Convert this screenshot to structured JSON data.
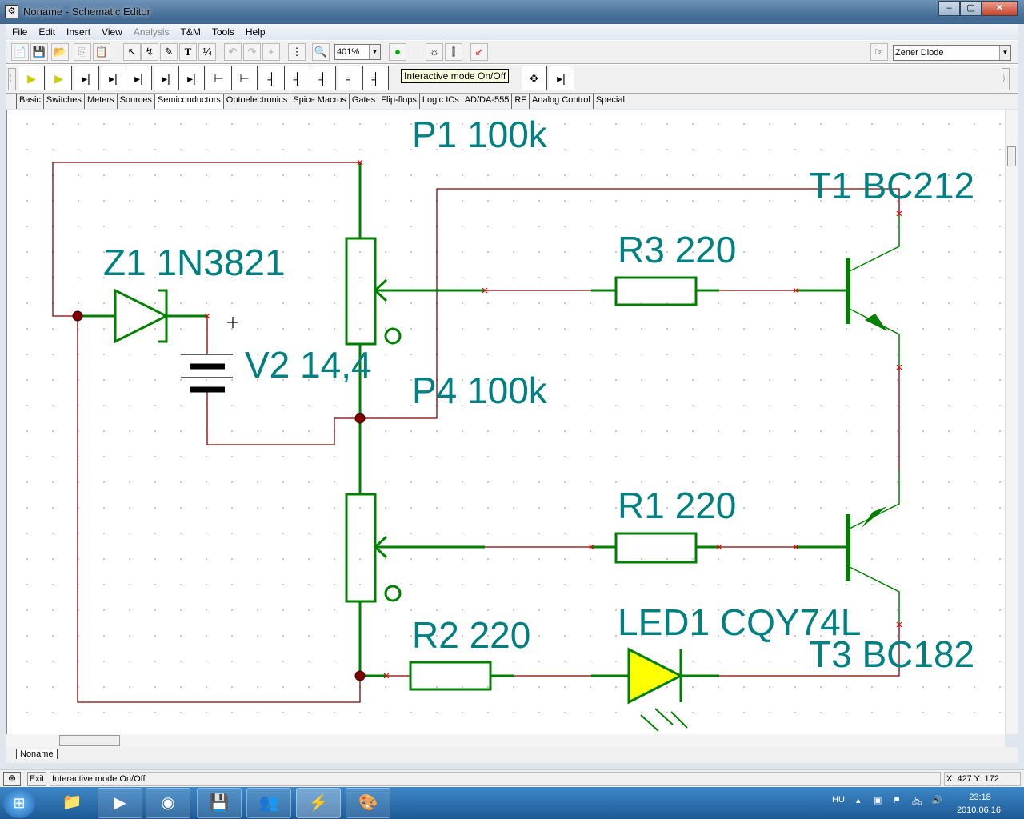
{
  "window": {
    "title": "Noname - Schematic Editor",
    "minimize": "–",
    "maximize": "▢",
    "close": "✕"
  },
  "menu": [
    "File",
    "Edit",
    "Insert",
    "View",
    "Analysis",
    "T&M",
    "Tools",
    "Help"
  ],
  "toolbar": {
    "zoom": "401%",
    "component": "Zener Diode"
  },
  "tooltip": "Interactive mode On/Off",
  "tabs": [
    "Basic",
    "Switches",
    "Meters",
    "Sources",
    "Semiconductors",
    "Optoelectronics",
    "Spice Macros",
    "Gates",
    "Flip-flops",
    "Logic ICs",
    "AD/DA-555",
    "RF",
    "Analog Control",
    "Special"
  ],
  "schematic": {
    "labels": {
      "p1": "P1 100k",
      "t1": "T1 BC212",
      "r3": "R3 220",
      "z1": "Z1 1N3821",
      "v2": "V2 14,4",
      "p4": "P4 100k",
      "r1": "R1 220",
      "r2": "R2 220",
      "led1": "LED1 CQY74L",
      "t3": "T3 BC182"
    },
    "colors": {
      "component": "#008000",
      "wire": "#800000",
      "label": "#008080",
      "junction": "#800000",
      "led_fill": "#ffff00"
    }
  },
  "document_tab": "Noname",
  "status": {
    "exit": "Exit",
    "message": "Interactive mode On/Off",
    "coords": "X: 427  Y: 172"
  },
  "taskbar": {
    "lang": "HU",
    "time": "23:18",
    "date": "2010.06.16."
  }
}
